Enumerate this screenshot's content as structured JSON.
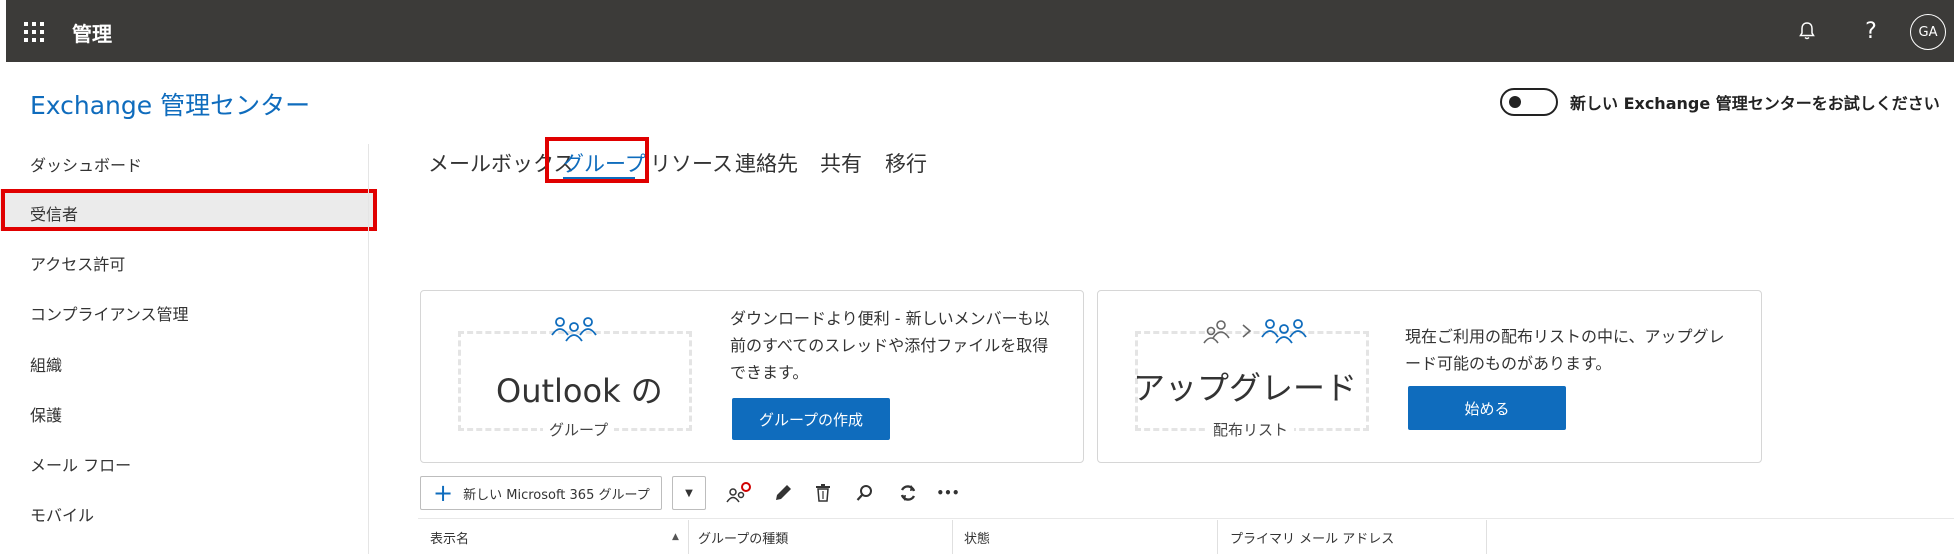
{
  "topbar": {
    "app_title": "管理",
    "avatar_initials": "GA",
    "bell_icon": "bell-icon",
    "help_icon": "?"
  },
  "header": {
    "eac_title": "Exchange 管理センター",
    "toggle_label": "新しい Exchange 管理センターをお試しください"
  },
  "sidebar": {
    "items": [
      {
        "label": "ダッシュボード"
      },
      {
        "label": "受信者"
      },
      {
        "label": "アクセス許可"
      },
      {
        "label": "コンプライアンス管理"
      },
      {
        "label": "組織"
      },
      {
        "label": "保護"
      },
      {
        "label": "メール フロー"
      },
      {
        "label": "モバイル"
      }
    ],
    "selected_index": 1
  },
  "tabs": [
    {
      "label": "メールボックス"
    },
    {
      "label": "グループ"
    },
    {
      "label": "リソース"
    },
    {
      "label": "連絡先"
    },
    {
      "label": "共有"
    },
    {
      "label": "移行"
    }
  ],
  "active_tab": 1,
  "cards": {
    "outlook": {
      "graphic_title": "Outlook の",
      "graphic_sub": "グループ",
      "desc_line1": "ダウンロードより便利 - 新しいメンバーも以",
      "desc_line2": "前のすべてのスレッドや添付ファイルを取得",
      "desc_line3": "できます。",
      "button": "グループの作成"
    },
    "upgrade": {
      "graphic_title": "アップグレード",
      "graphic_sub": "配布リスト",
      "desc_line1": "現在ご利用の配布リストの中に、アップグレ",
      "desc_line2": "ード可能のものがあります。",
      "button": "始める"
    }
  },
  "toolbar": {
    "new_label": "新しい Microsoft 365 グループ",
    "more": "•••"
  },
  "table": {
    "columns": [
      "表示名",
      "グループの種類",
      "状態",
      "プライマリ メール アドレス"
    ]
  },
  "colors": {
    "accent": "#0f6cbd",
    "topbar": "#3c3b39",
    "highlight": "#e00000"
  }
}
